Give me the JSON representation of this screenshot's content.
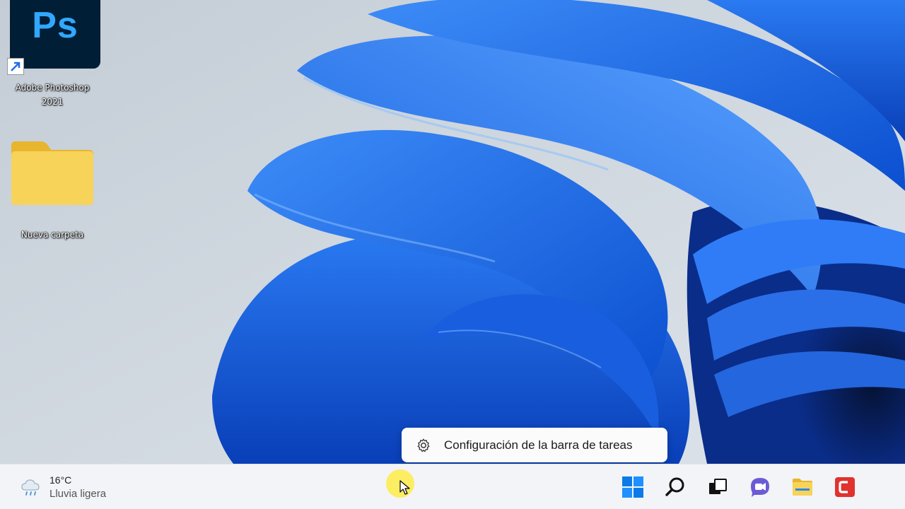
{
  "desktop": {
    "icons": [
      {
        "label": "Adobe Photoshop 2021",
        "glyph": "Ps",
        "icon": "photoshop-icon"
      },
      {
        "label": "Nueva carpeta",
        "icon": "folder-icon"
      }
    ]
  },
  "tooltip": {
    "label": "Configuración de la barra de tareas",
    "icon": "gear-icon"
  },
  "taskbar": {
    "weather": {
      "temp": "16°C",
      "condition": "Lluvia ligera",
      "icon": "rain-cloud-icon"
    },
    "pinned": [
      "start-button",
      "search-button",
      "task-view-button",
      "chat-button",
      "file-explorer-button",
      "app-button"
    ]
  },
  "colors": {
    "taskbar_bg": "#f2f4f7",
    "wallpaper_blue": "#1f6fe8",
    "wallpaper_bg": "#cfd7df",
    "ps_bg": "#001e36",
    "ps_text": "#31a8ff",
    "folder_yellow": "#f6c94a",
    "cursor_highlight": "#ffeb3c"
  }
}
